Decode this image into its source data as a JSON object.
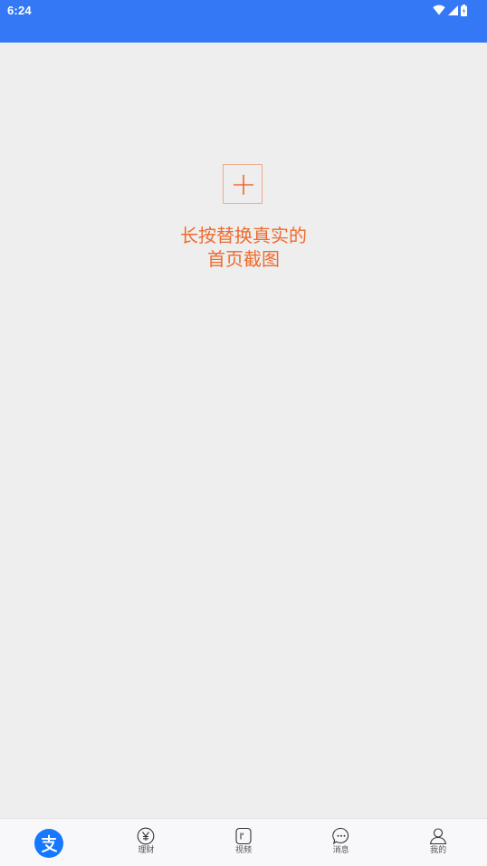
{
  "status_bar": {
    "time": "6:24",
    "background": "#3478f6",
    "icons": [
      "wifi-icon",
      "signal-icon",
      "battery-icon"
    ]
  },
  "main": {
    "add_icon": "plus-icon",
    "hint_line1": "长按替换真实的",
    "hint_line2": "首页截图",
    "accent": "#ef6a2c"
  },
  "tab_bar": {
    "tabs": [
      {
        "icon": "alipay-logo-icon",
        "label": "",
        "selected": true
      },
      {
        "icon": "yen-icon",
        "label": "理财"
      },
      {
        "icon": "video-icon",
        "label": "视频"
      },
      {
        "icon": "message-icon",
        "label": "消息"
      },
      {
        "icon": "person-icon",
        "label": "我的"
      }
    ],
    "accent": "#1677ff"
  }
}
